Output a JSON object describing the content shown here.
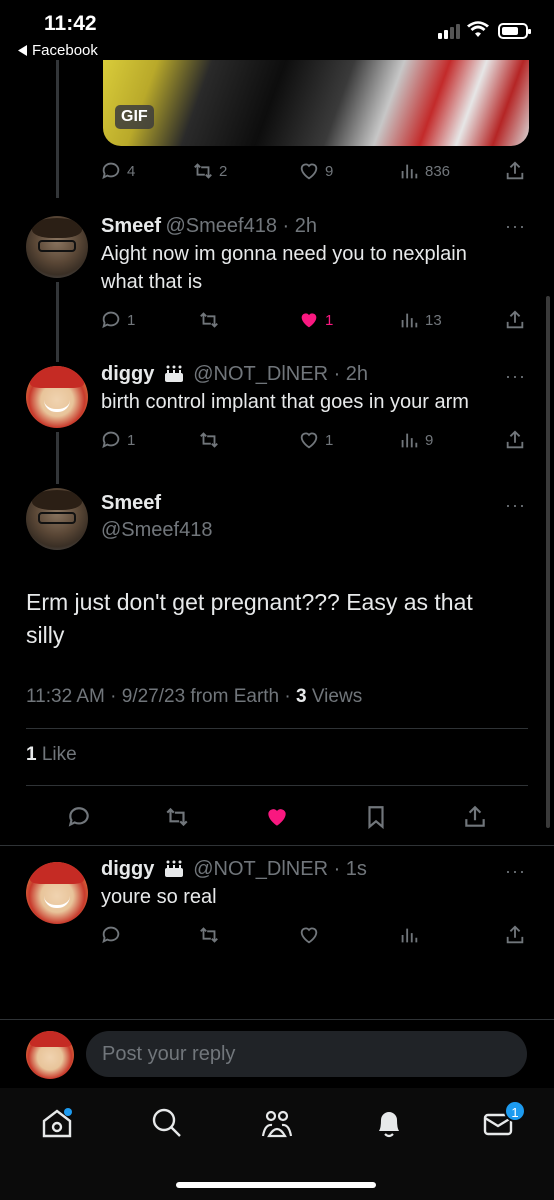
{
  "status_bar": {
    "time": "11:42",
    "back_app": "Facebook"
  },
  "gif_badge": "GIF",
  "top_tweet_actions": {
    "replies": "4",
    "retweets": "2",
    "likes": "9",
    "views": "836"
  },
  "reply1": {
    "name": "Smeef",
    "handle": "@Smeef418 · 2h",
    "text": "Aight now im gonna need you to nexplain what that is",
    "actions": {
      "replies": "1",
      "likes": "1",
      "views": "13"
    }
  },
  "reply2": {
    "name": "diggy",
    "handle": "@NOT_DlNER · 2h",
    "text": "birth control implant that goes in your arm",
    "actions": {
      "replies": "1",
      "likes": "1",
      "views": "9"
    }
  },
  "main_tweet": {
    "name": "Smeef",
    "handle": "@Smeef418",
    "text": "Erm just don't get pregnant??? Easy as that silly",
    "meta_prefix": "11:32 AM · 9/27/23 from Earth · ",
    "views_count": "3",
    "views_label": " Views",
    "likes_count": "1",
    "likes_label": " Like"
  },
  "reply3": {
    "name": "diggy",
    "handle": "@NOT_DlNER · 1s",
    "text": "youre so real"
  },
  "reply_input": {
    "placeholder": "Post your reply"
  },
  "more_glyph": "···",
  "notification_badge": "1",
  "colors": {
    "like_pink": "#f91880",
    "accent_blue": "#1d9bf0",
    "muted": "#71767b"
  }
}
